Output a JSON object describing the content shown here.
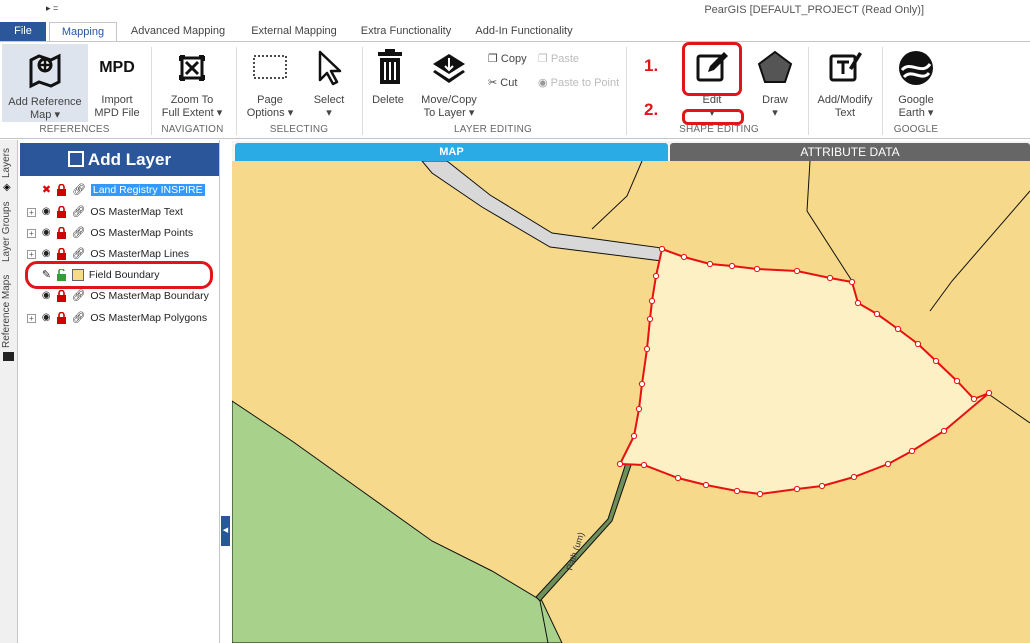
{
  "app": {
    "title": "PearGIS [DEFAULT_PROJECT (Read Only)]",
    "qat": "▸ ="
  },
  "tabs": {
    "file": "File",
    "mapping": "Mapping",
    "advanced": "Advanced Mapping",
    "external": "External Mapping",
    "extra": "Extra Functionality",
    "addin": "Add-In Functionality"
  },
  "ribbon": {
    "add_reference_map": "Add Reference",
    "add_reference_map2": "Map ▾",
    "mpd_icon_text": "MPD",
    "import_mpd": "Import",
    "import_mpd2": "MPD File",
    "zoom_to": "Zoom To",
    "zoom_to2": "Full Extent ▾",
    "page_options": "Page",
    "page_options2": "Options ▾",
    "select": "Select",
    "select2": "▾",
    "delete": "Delete",
    "move_copy": "Move/Copy",
    "move_copy2": "To Layer ▾",
    "copy": "Copy",
    "paste": "Paste",
    "cut": "Cut",
    "paste_to_point": "Paste to Point",
    "edit": "Edit",
    "edit2": "▾",
    "draw": "Draw",
    "draw2": "▾",
    "add_modify": "Add/Modify",
    "add_modify2": "Text",
    "google_earth": "Google",
    "google_earth2": "Earth ▾",
    "groups": {
      "references": "REFERENCES",
      "navigation": "NAVIGATION",
      "selecting": "SELECTING",
      "layer_editing": "LAYER EDITING",
      "shape_editing": "SHAPE EDITING",
      "google": "GOOGLE"
    }
  },
  "annotations": {
    "step1": "1.",
    "step2": "2.",
    "color": "#e0151a"
  },
  "sidetabs": {
    "layers": "Layers",
    "layer_groups": "Layer Groups",
    "reference_maps": "Reference Maps"
  },
  "layers": {
    "add_layer": "Add Layer",
    "items": [
      {
        "name": "Land Registry INSPIRE",
        "selected": true
      },
      {
        "name": "OS MasterMap Text"
      },
      {
        "name": "OS MasterMap Points"
      },
      {
        "name": "OS MasterMap Lines"
      },
      {
        "name": "Field Boundary",
        "editing": true
      },
      {
        "name": "OS MasterMap Boundary"
      },
      {
        "name": "OS MasterMap Polygons"
      }
    ]
  },
  "map": {
    "tab_map": "MAP",
    "tab_attribute": "ATTRIBUTE DATA",
    "path_label": "Path (um)",
    "colors": {
      "land": "#f6d98a",
      "grass": "#a8d18b",
      "road": "#d8d8d8",
      "selected_polygon": "#fdf0c4",
      "selected_outline": "#e81010"
    }
  }
}
